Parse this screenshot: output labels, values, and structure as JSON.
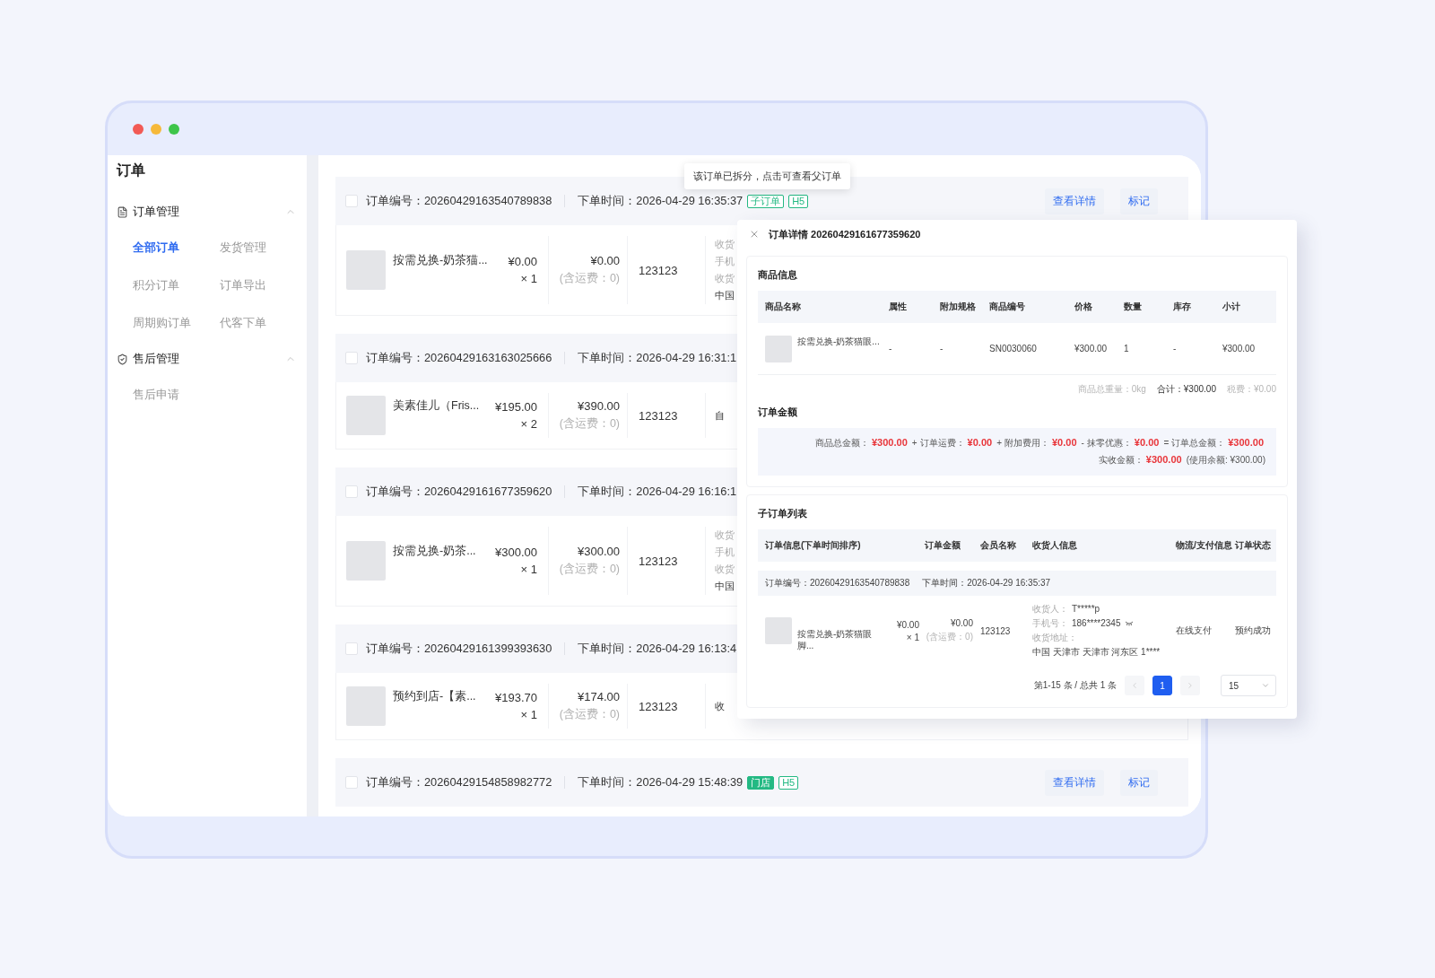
{
  "sidebar": {
    "title": "订单",
    "groups": [
      {
        "label": "订单管理",
        "kind": "document",
        "expanded": true,
        "items": [
          {
            "label": "全部订单",
            "selected": true
          },
          {
            "label": "发货管理",
            "selected": false
          },
          {
            "label": "积分订单",
            "selected": false
          },
          {
            "label": "订单导出",
            "selected": false
          },
          {
            "label": "周期购订单",
            "selected": false
          },
          {
            "label": "代客下单",
            "selected": false
          }
        ]
      },
      {
        "label": "售后管理",
        "kind": "shield",
        "expanded": true,
        "items": [
          {
            "label": "售后申请",
            "selected": false
          }
        ]
      }
    ]
  },
  "tooltip": "该订单已拆分，点击可查看父订单",
  "orders": [
    {
      "checked": false,
      "number": "订单编号：20260429163540789838",
      "time": "下单时间：2026-04-29 16:35:37",
      "tags": [
        {
          "label": "子订单",
          "kind": "outline"
        },
        {
          "label": "H5",
          "kind": "outline"
        }
      ],
      "actions": [
        "查看详情",
        "标记"
      ],
      "product": {
        "name": "按需兑换-奶茶猫...",
        "price": "¥0.00",
        "qty": "× 1"
      },
      "total": "¥0.00",
      "shipping": "(含运费：0)",
      "member": "123123",
      "receiver": [
        {
          "text": "收货",
          "kind": "label"
        },
        {
          "text": "手机",
          "kind": "label"
        },
        {
          "text": "收货",
          "kind": "label"
        },
        {
          "text": "中国",
          "kind": "value"
        }
      ]
    },
    {
      "checked": false,
      "number": "订单编号：20260429163163025666",
      "time": "下单时间：2026-04-29 16:31:1",
      "product": {
        "name": "美素佳儿（Fris...",
        "price": "¥195.00",
        "qty": "× 2"
      },
      "total": "¥390.00",
      "shipping": "(含运费：0)",
      "member": "123123",
      "receiver": [
        {
          "text": "自",
          "kind": "value"
        }
      ]
    },
    {
      "checked": false,
      "number": "订单编号：20260429161677359620",
      "time": "下单时间：2026-04-29 16:16:1",
      "product": {
        "name": "按需兑换-奶茶...",
        "price": "¥300.00",
        "qty": "× 1"
      },
      "total": "¥300.00",
      "shipping": "(含运费：0)",
      "member": "123123",
      "receiver": [
        {
          "text": "收货",
          "kind": "label"
        },
        {
          "text": "手机",
          "kind": "label"
        },
        {
          "text": "收货",
          "kind": "label"
        },
        {
          "text": "中国",
          "kind": "value"
        }
      ]
    },
    {
      "checked": false,
      "number": "订单编号：20260429161399393630",
      "time": "下单时间：2026-04-29 16:13:4",
      "product": {
        "name": "预约到店-【素...",
        "price": "¥193.70",
        "qty": "× 1"
      },
      "total": "¥174.00",
      "shipping": "(含运费：0)",
      "member": "123123",
      "receiver": [
        {
          "text": "收",
          "kind": "value"
        }
      ]
    },
    {
      "checked": false,
      "number": "订单编号：20260429154858982772",
      "time": "下单时间：2026-04-29 15:48:39",
      "tags": [
        {
          "label": "门店",
          "kind": "filled"
        },
        {
          "label": "H5",
          "kind": "outline"
        }
      ],
      "actions": [
        "查看详情",
        "标记"
      ]
    }
  ],
  "detail": {
    "title": "订单详情 20260429161677359620",
    "goods": {
      "heading": "商品信息",
      "columns": [
        "商品名称",
        "属性",
        "附加规格",
        "商品编号",
        "价格",
        "数量",
        "库存",
        "小计"
      ],
      "rows": [
        {
          "cells": [
            "按需兑换-奶茶猫眼...",
            "-",
            "-",
            "SN0030060",
            "¥300.00",
            "1",
            "-",
            "¥300.00"
          ]
        }
      ],
      "summary": [
        {
          "text": "商品总重量：0kg",
          "kind": "muted"
        },
        {
          "text": "合计：¥300.00",
          "kind": "strong"
        },
        {
          "text": "税费：¥0.00",
          "kind": "muted"
        }
      ]
    },
    "amount": {
      "heading": "订单金额",
      "terms": [
        {
          "label": "商品总金额：",
          "amount": "¥300.00"
        },
        {
          "operator": "+",
          "label": "订单运费：",
          "amount": "¥0.00"
        },
        {
          "operator": "+",
          "label": "附加费用：",
          "amount": "¥0.00"
        },
        {
          "operator": "-",
          "label": "抹零优惠：",
          "amount": "¥0.00"
        },
        {
          "operator": "=",
          "label": "订单总金额：",
          "amount": "¥300.00"
        }
      ],
      "received": {
        "label": "实收金额：",
        "amount": "¥300.00",
        "note": "(使用余额: ¥300.00)"
      }
    },
    "suborders": {
      "heading": "子订单列表",
      "columns": [
        "订单信息(下单时间排序)",
        "订单金额",
        "会员名称",
        "收货人信息",
        "物流/支付信息",
        "订单状态"
      ],
      "orders": [
        {
          "number": "订单编号：20260429163540789838",
          "time": "下单时间：2026-04-29 16:35:37",
          "name": "按需兑换-奶茶猫眼脚...",
          "price": "¥0.00",
          "qty": "× 1",
          "total": "¥0.00",
          "shipping": "(含运费：0)",
          "member": "123123",
          "receiver": {
            "name_label": "收货人：",
            "name": "T*****p",
            "phone_label": "手机号：",
            "phone": "186****2345",
            "address_label": "收货地址：",
            "address": "中国 天津市 天津市 河东区 1****"
          },
          "payment": "在线支付",
          "status": "预约成功"
        }
      ]
    },
    "pagination": {
      "summary": "第1-15 条 / 总共 1 条",
      "prev_disabled": true,
      "pages": [
        {
          "label": "1",
          "selected": true
        }
      ],
      "next_disabled": true,
      "page_size": "15"
    }
  }
}
